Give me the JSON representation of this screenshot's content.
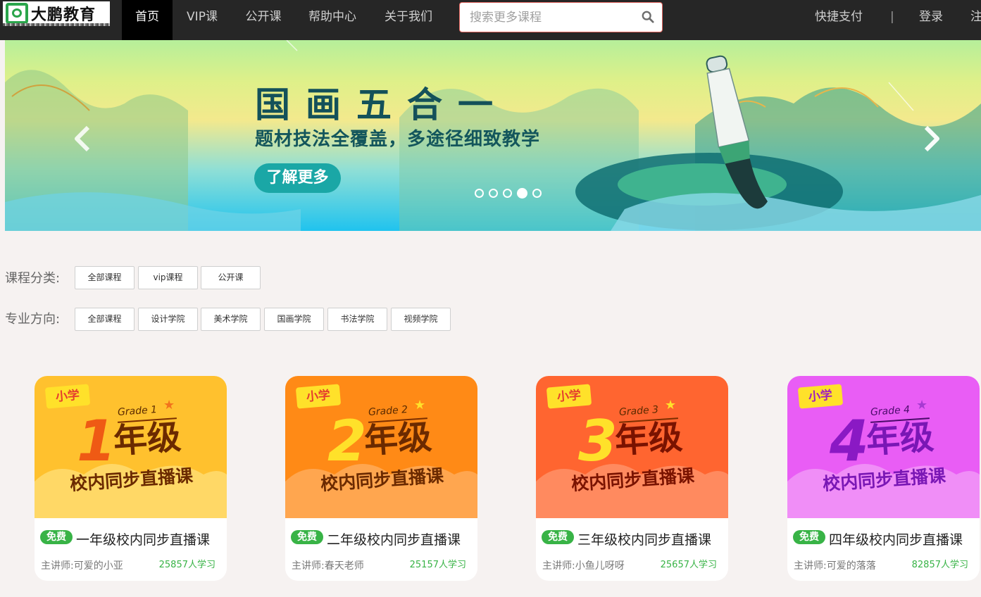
{
  "header": {
    "logo_text": "大鹏教育",
    "nav": [
      {
        "label": "首页",
        "active": true
      },
      {
        "label": "VIP课",
        "active": false
      },
      {
        "label": "公开课",
        "active": false
      },
      {
        "label": "帮助中心",
        "active": false
      },
      {
        "label": "关于我们",
        "active": false
      }
    ],
    "search": {
      "placeholder": "搜索更多课程",
      "value": "",
      "icon": "search-icon"
    },
    "quick_pay": "快捷支付",
    "divider": "|",
    "login": "登录",
    "register": "注"
  },
  "banner": {
    "title": "国画五合一",
    "subtitle": "题材技法全覆盖，多途径细致教学",
    "button": "了解更多",
    "slide_count": 5,
    "active_slide": 4,
    "colors": {
      "accent": "#1aa7a6",
      "title": "#14515a"
    }
  },
  "filters": {
    "category_label": "课程分类:",
    "category_chips": [
      "全部课程",
      "vip课程",
      "公开课"
    ],
    "major_label": "专业方向:",
    "major_chips": [
      "全部课程",
      "设计学院",
      "美术学院",
      "国画学院",
      "书法学院",
      "视频学院"
    ]
  },
  "courses": [
    {
      "tag": "小学",
      "grade_en": "Grade 1",
      "grade_num": "1",
      "grade_cn": "年级",
      "subtitle": "校内同步直播课",
      "badge": "免费",
      "title": "一年级校内同步直播课",
      "teacher": "主讲师:可爱的小亚",
      "learners": "25857人学习",
      "theme": "yellow"
    },
    {
      "tag": "小学",
      "grade_en": "Grade 2",
      "grade_num": "2",
      "grade_cn": "年级",
      "subtitle": "校内同步直播课",
      "badge": "免费",
      "title": "二年级校内同步直播课",
      "teacher": "主讲师:春天老师",
      "learners": "25157人学习",
      "theme": "orange"
    },
    {
      "tag": "小学",
      "grade_en": "Grade 3",
      "grade_num": "3",
      "grade_cn": "年级",
      "subtitle": "校内同步直播课",
      "badge": "免费",
      "title": "三年级校内同步直播课",
      "teacher": "主讲师:小鱼儿呀呀",
      "learners": "25657人学习",
      "theme": "red"
    },
    {
      "tag": "小学",
      "grade_en": "Grade 4",
      "grade_num": "4",
      "grade_cn": "年级",
      "subtitle": "校内同步直播课",
      "badge": "免费",
      "title": "四年级校内同步直播课",
      "teacher": "主讲师:可爱的落落",
      "learners": "82857人学习",
      "theme": "purple"
    }
  ]
}
